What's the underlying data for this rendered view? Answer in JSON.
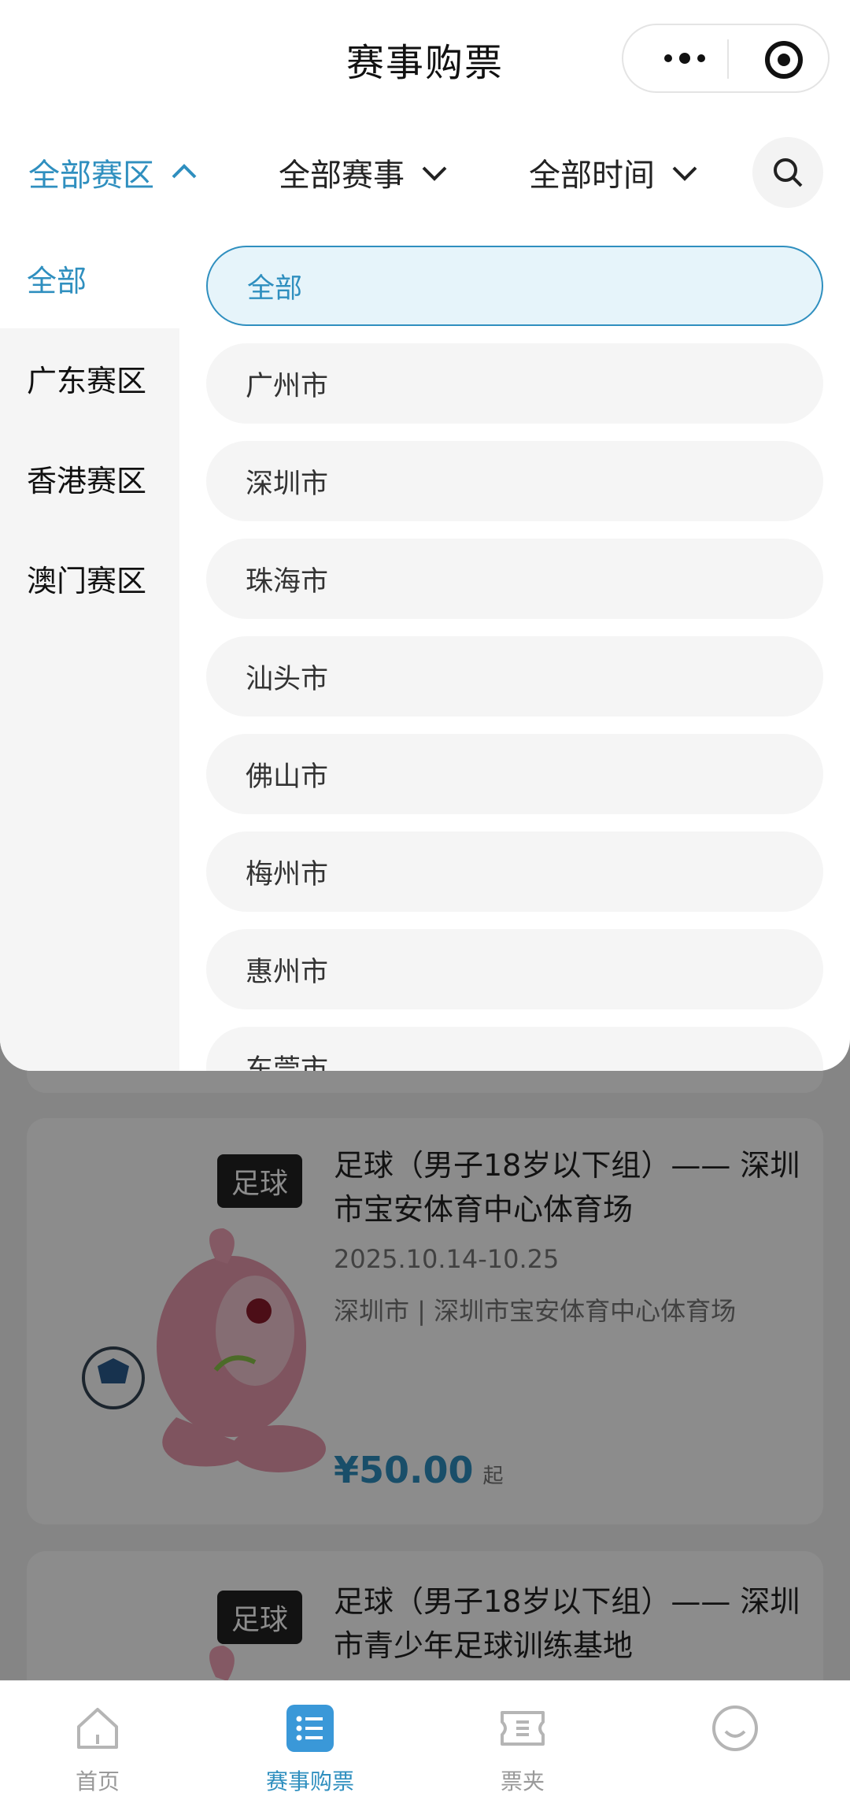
{
  "header": {
    "title": "赛事购票"
  },
  "filters": [
    {
      "label": "全部赛区",
      "active": true
    },
    {
      "label": "全部赛事",
      "active": false
    },
    {
      "label": "全部时间",
      "active": false
    }
  ],
  "regions": [
    {
      "label": "全部",
      "active": true
    },
    {
      "label": "广东赛区",
      "active": false
    },
    {
      "label": "香港赛区",
      "active": false
    },
    {
      "label": "澳门赛区",
      "active": false
    }
  ],
  "cities": [
    {
      "label": "全部",
      "active": true
    },
    {
      "label": "广州市"
    },
    {
      "label": "深圳市"
    },
    {
      "label": "珠海市"
    },
    {
      "label": "汕头市"
    },
    {
      "label": "佛山市"
    },
    {
      "label": "梅州市"
    },
    {
      "label": "惠州市"
    },
    {
      "label": "东莞市"
    }
  ],
  "events": [
    {
      "tag": "足球",
      "title": "足球（男子18岁以下组）—— 深圳市宝安体育中心体育场",
      "date": "2025.10.14-10.25",
      "venue": "深圳市 | 深圳市宝安体育中心体育场",
      "price": "¥50.00",
      "price_suffix": "起"
    },
    {
      "tag": "足球",
      "title": "足球（男子18岁以下组）—— 深圳市青少年足球训练基地"
    }
  ],
  "tabbar": [
    {
      "label": "首页",
      "icon": "home-icon"
    },
    {
      "label": "赛事购票",
      "icon": "list-icon",
      "active": true
    },
    {
      "label": "票夹",
      "icon": "ticket-icon"
    },
    {
      "label": "",
      "icon": "smile-icon"
    }
  ],
  "colors": {
    "accent": "#2f8fbf",
    "mask": "rgba(0,0,0,0.45)"
  }
}
